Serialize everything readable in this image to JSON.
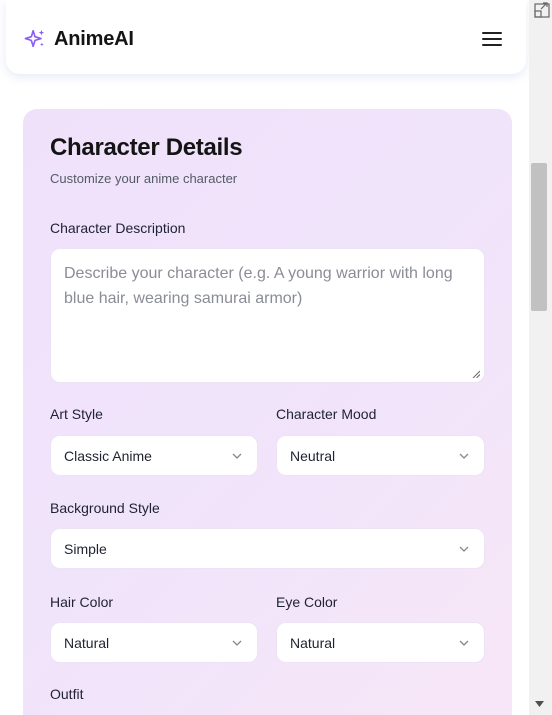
{
  "app": {
    "name": "AnimeAI"
  },
  "icons": {
    "logo": "sparkles-icon",
    "menu": "hamburger-menu-icon",
    "dropdown": "chevron-down-icon"
  },
  "colors": {
    "accent": "#8b5cf6",
    "card_bg": "#efe1fa"
  },
  "card": {
    "title": "Character Details",
    "subtitle": "Customize your anime character"
  },
  "form": {
    "description": {
      "label": "Character Description",
      "placeholder": "Describe your character (e.g. A young warrior with long blue hair, wearing samurai armor)"
    },
    "art_style": {
      "label": "Art Style",
      "value": "Classic Anime"
    },
    "mood": {
      "label": "Character Mood",
      "value": "Neutral"
    },
    "background": {
      "label": "Background Style",
      "value": "Simple"
    },
    "hair": {
      "label": "Hair Color",
      "value": "Natural"
    },
    "eye": {
      "label": "Eye Color",
      "value": "Natural"
    },
    "outfit": {
      "label": "Outfit"
    }
  }
}
